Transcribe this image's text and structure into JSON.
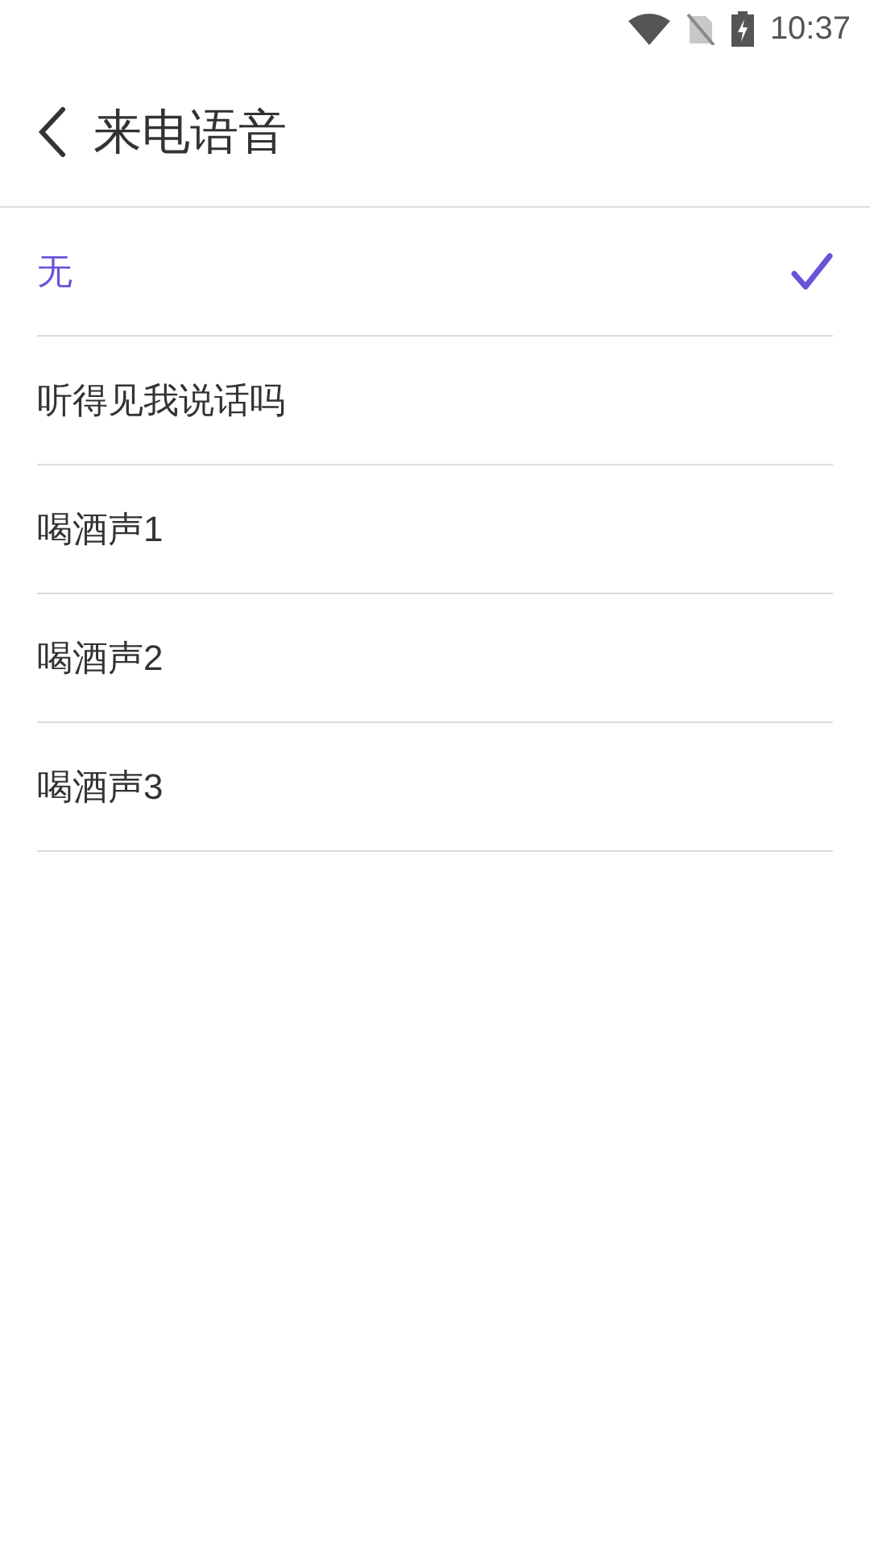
{
  "status_bar": {
    "time": "10:37"
  },
  "header": {
    "title": "来电语音"
  },
  "options": [
    {
      "label": "无",
      "selected": true
    },
    {
      "label": "听得见我说话吗",
      "selected": false
    },
    {
      "label": "喝酒声1",
      "selected": false
    },
    {
      "label": "喝酒声2",
      "selected": false
    },
    {
      "label": "喝酒声3",
      "selected": false
    }
  ]
}
